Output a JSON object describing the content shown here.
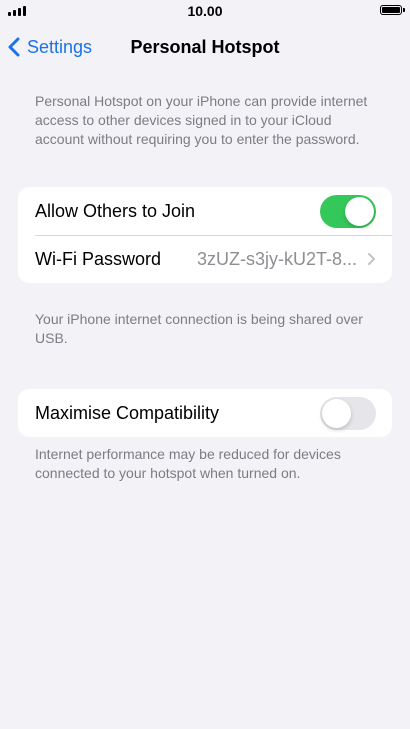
{
  "status_bar": {
    "time": "10.00",
    "icons": [
      "signal-icon",
      "battery-icon"
    ]
  },
  "nav": {
    "back_label": "Settings",
    "back_icon": "chevron-left-icon",
    "title": "Personal Hotspot"
  },
  "intro_text": "Personal Hotspot on your iPhone can provide internet access to other devices signed in to your iCloud account without requiring you to enter the password.",
  "group_main": {
    "allow_others": {
      "label": "Allow Others to Join",
      "toggle_on": true
    },
    "wifi_password": {
      "label": "Wi-Fi Password",
      "value": "3zUZ-s3jy-kU2T-8..."
    }
  },
  "usb_text": "Your iPhone internet connection is being shared over USB.",
  "group_compat": {
    "maximise": {
      "label": "Maximise Compatibility",
      "toggle_on": false
    }
  },
  "compat_text": "Internet performance may be reduced for devices connected to your hotspot when turned on.",
  "colors": {
    "accent": "#1a73e8",
    "toggle_on": "#34c759",
    "toggle_off": "#e5e5ea",
    "background": "#f2f2f7",
    "secondary_text": "#7c7c82"
  }
}
